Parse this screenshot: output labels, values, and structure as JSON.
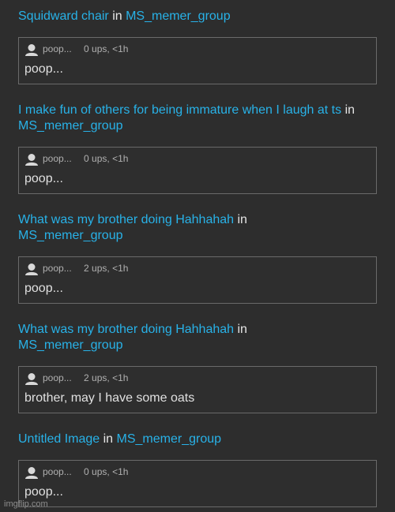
{
  "posts": [
    {
      "title_link": "Squidward chair",
      "in_word": "in",
      "group": "MS_memer_group",
      "comment": {
        "author": "poop...",
        "stats": "0 ups, <1h",
        "text": "poop..."
      }
    },
    {
      "title_link": "I make fun of others for being immature when I laugh at ts",
      "in_word": "in",
      "group": "MS_memer_group",
      "comment": {
        "author": "poop...",
        "stats": "0 ups, <1h",
        "text": "poop..."
      }
    },
    {
      "title_link": "What was my brother doing Hahhahah",
      "in_word": "in",
      "group": "MS_memer_group",
      "comment": {
        "author": "poop...",
        "stats": "2 ups, <1h",
        "text": "poop..."
      }
    },
    {
      "title_link": "What was my brother doing Hahhahah",
      "in_word": "in",
      "group": "MS_memer_group",
      "comment": {
        "author": "poop...",
        "stats": "2 ups, <1h",
        "text": "brother, may I have some oats"
      }
    },
    {
      "title_link": "Untitled Image",
      "in_word": "in",
      "group": "MS_memer_group",
      "comment": {
        "author": "poop...",
        "stats": "0 ups, <1h",
        "text": "poop..."
      }
    }
  ],
  "icons": {
    "avatar": "user-avatar-icon"
  },
  "colors": {
    "background": "#2d2d2d",
    "link": "#28b2e8",
    "text": "#e6e6e6",
    "meta": "#b0b0b0",
    "border": "#6a6a6a"
  },
  "watermark": "imgflip.com"
}
